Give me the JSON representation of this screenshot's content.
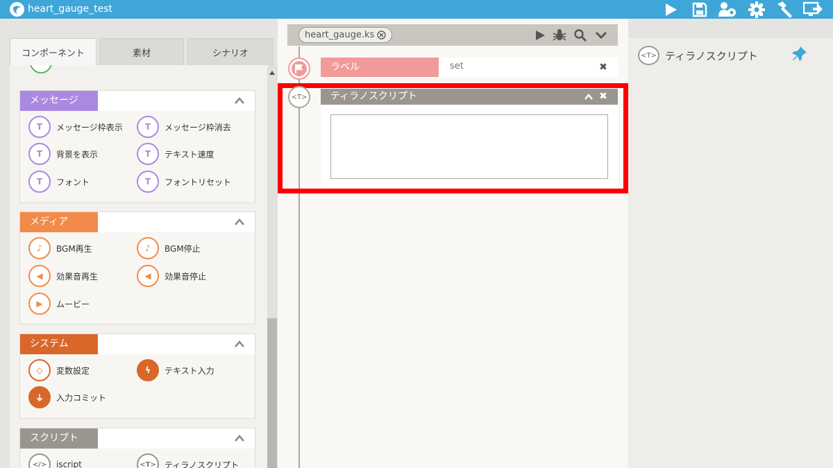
{
  "app": {
    "title": "heart_gauge_test"
  },
  "colors": {
    "topbar": "#3fa6d8",
    "message": "#a98ae0",
    "media": "#f28b4a",
    "system": "#d9672a",
    "script": "#9a968f",
    "label": "#f19a9a",
    "highlight": "#ff0000"
  },
  "left": {
    "tabs": [
      "コンポーネント",
      "素材",
      "シナリオ"
    ],
    "sections": {
      "message": {
        "title": "メッセージ",
        "items": [
          "メッセージ枠表示",
          "メッセージ枠消去",
          "背景を表示",
          "テキスト速度",
          "フォント",
          "フォントリセット"
        ]
      },
      "media": {
        "title": "メディア",
        "items": [
          "BGM再生",
          "BGM停止",
          "効果音再生",
          "効果音停止",
          "ムービー"
        ]
      },
      "system": {
        "title": "システム",
        "items": [
          "変数設定",
          "テキスト入力",
          "入力コミット"
        ]
      },
      "script": {
        "title": "スクリプト",
        "items": [
          "iscript",
          "ティラノスクリプト"
        ]
      }
    }
  },
  "center": {
    "file_tab": "heart_gauge.ks",
    "label_block": {
      "tag": "ラベル",
      "value": "set"
    },
    "tyrano_block": {
      "tag": "ティラノスクリプト",
      "content": ""
    }
  },
  "right": {
    "label": "ティラノスクリプト"
  },
  "icons": [
    "play-icon",
    "save-icon",
    "users-gear-icon",
    "gear-icon",
    "hammer-icon",
    "export-icon",
    "bug-icon",
    "search-icon",
    "chevron-down-icon",
    "pin-icon"
  ]
}
